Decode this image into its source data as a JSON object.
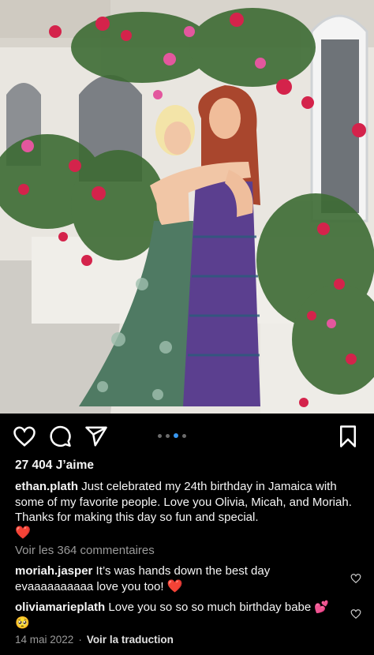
{
  "post": {
    "likes": "27 404 J’aime",
    "caption": {
      "username": "ethan.plath",
      "text": "Just celebrated my 24th birthday in Jamaica with some of my favorite people. Love you Olivia, Micah, and Moriah. Thanks for making this day so fun and special.",
      "emoji": "❤️"
    },
    "view_comments": "Voir les 364 commentaires",
    "comments": [
      {
        "username": "moriah.jasper",
        "text": "It’s was hands down the best day evaaaaaaaaaa love you too!",
        "emoji": "❤️"
      },
      {
        "username": "oliviamarieplath",
        "text": "Love you so so so much birthday babe",
        "emoji": "💕🥺"
      }
    ],
    "date": "14 mai 2022",
    "translate": "Voir la traduction"
  },
  "carousel": {
    "count": 4,
    "active": 2
  },
  "icons": [
    "heart-icon",
    "comment-icon",
    "share-icon",
    "bookmark-icon"
  ],
  "colors": {
    "background": "#000000",
    "text": "#f5f5f5",
    "muted": "#9a9a9a",
    "carousel_active": "#3897f0",
    "heart": "#e0242b"
  }
}
